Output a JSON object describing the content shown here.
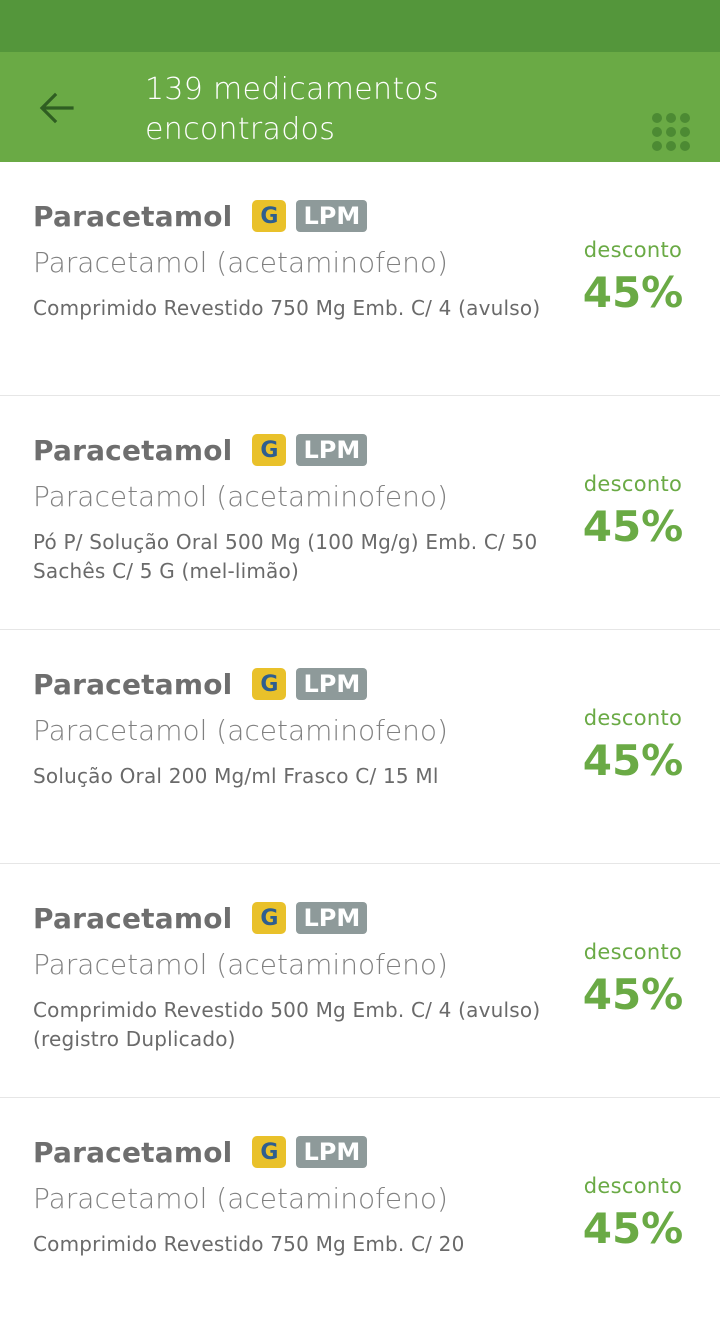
{
  "header": {
    "title": "139 medicamentos encontrados",
    "back_icon": "arrow-left-icon",
    "grid_icon": "grid-icon"
  },
  "colors": {
    "status_bar": "#54963b",
    "app_bar": "#6aaa45",
    "accent": "#6aaa45",
    "badge_g": "#e9c12a",
    "badge_lpm": "#8e9a9a"
  },
  "items": [
    {
      "name": "Paracetamol",
      "badge_g": "G",
      "badge_lpm": "LPM",
      "substance": "Paracetamol (acetaminofeno)",
      "presentation": "Comprimido Revestido 750 Mg Emb. C/ 4 (avulso)",
      "discount_label": "desconto",
      "discount_value": "45%"
    },
    {
      "name": "Paracetamol",
      "badge_g": "G",
      "badge_lpm": "LPM",
      "substance": "Paracetamol (acetaminofeno)",
      "presentation": "Pó P/ Solução Oral 500 Mg (100 Mg/g) Emb. C/ 50 Sachês C/ 5 G (mel-limão)",
      "discount_label": "desconto",
      "discount_value": "45%"
    },
    {
      "name": "Paracetamol",
      "badge_g": "G",
      "badge_lpm": "LPM",
      "substance": "Paracetamol (acetaminofeno)",
      "presentation": "Solução Oral 200 Mg/ml Frasco C/ 15 Ml",
      "discount_label": "desconto",
      "discount_value": "45%"
    },
    {
      "name": "Paracetamol",
      "badge_g": "G",
      "badge_lpm": "LPM",
      "substance": "Paracetamol (acetaminofeno)",
      "presentation": "Comprimido Revestido 500 Mg Emb. C/ 4 (avulso) (registro Duplicado)",
      "discount_label": "desconto",
      "discount_value": "45%"
    },
    {
      "name": "Paracetamol",
      "badge_g": "G",
      "badge_lpm": "LPM",
      "substance": "Paracetamol (acetaminofeno)",
      "presentation": "Comprimido Revestido 750 Mg Emb. C/ 20",
      "discount_label": "desconto",
      "discount_value": "45%"
    }
  ]
}
